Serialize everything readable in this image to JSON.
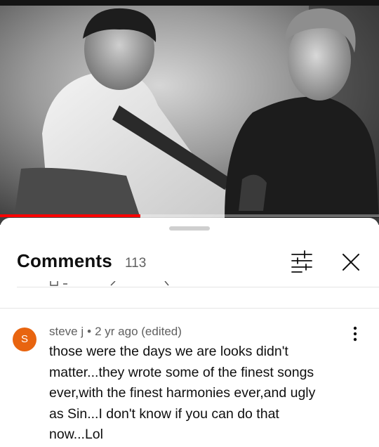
{
  "video": {
    "progress_fraction": 0.37,
    "progress_color": "#ff0000"
  },
  "comments_panel": {
    "title": "Comments",
    "count": "113",
    "filter_icon": "filter-sliders-icon",
    "close_icon": "close-x-icon"
  },
  "comment": {
    "avatar_letter": "S",
    "avatar_color": "#e8640f",
    "author": "steve j",
    "separator": "•",
    "time": "2 yr ago (edited)",
    "lines": [
      "those were the days we are looks didn't",
      "matter...they wrote some of the finest songs",
      "ever,with the finest harmonies ever,and  ugly",
      "as Sin...I don't know if you can do that",
      "now...Lol"
    ],
    "more_icon": "more-vertical-icon"
  }
}
